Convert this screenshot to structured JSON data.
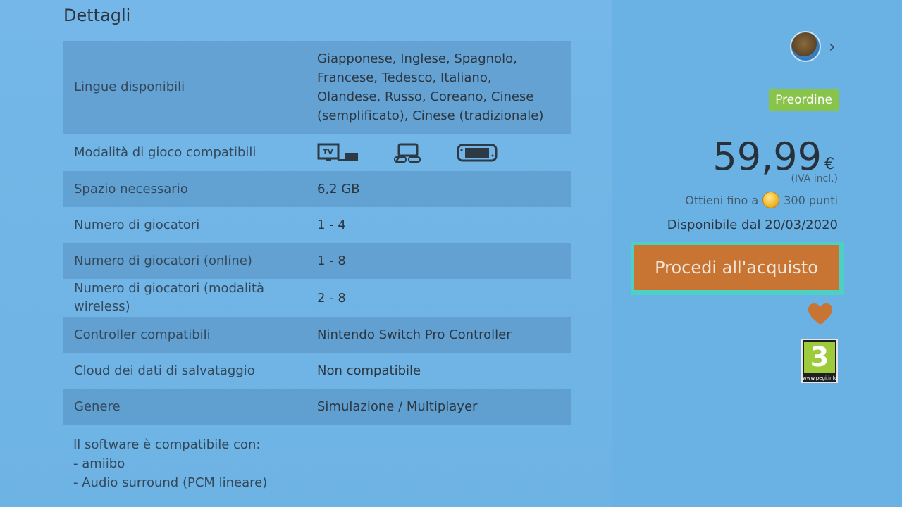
{
  "details": {
    "title": "Dettagli",
    "rows": [
      {
        "key": "Lingue disponibili",
        "value_lines": [
          "Giapponese, Inglese, Spagnolo,",
          "Francese, Tedesco, Italiano,",
          "Olandese, Russo, Coreano, Cinese",
          "(semplificato), Cinese (tradizionale)"
        ]
      },
      {
        "key": "Modalità di gioco compatibili",
        "modes": [
          "tv-mode-icon",
          "tabletop-mode-icon",
          "handheld-mode-icon"
        ]
      },
      {
        "key": "Spazio necessario",
        "value": "6,2 GB"
      },
      {
        "key": "Numero di giocatori",
        "value": "1 - 4"
      },
      {
        "key": "Numero di giocatori (online)",
        "value": "1 - 8"
      },
      {
        "key_lines": [
          "Numero di giocatori (modalità",
          "wireless)"
        ],
        "value": "2 - 8"
      },
      {
        "key": "Controller compatibili",
        "value": "Nintendo Switch Pro Controller"
      },
      {
        "key": "Cloud dei dati di salvataggio",
        "value": "Non compatibile"
      },
      {
        "key": "Genere",
        "value": "Simulazione / Multiplayer"
      }
    ],
    "compat": {
      "heading": "Il software è compatibile con:",
      "items": [
        "- amiibo",
        "- Audio surround (PCM lineare)"
      ]
    }
  },
  "sidebar": {
    "badge": "Preordine",
    "price": "59,99",
    "currency": "€",
    "vat_note": "(IVA incl.)",
    "points_prefix": "Ottieni fino a",
    "points_value": "300 punti",
    "release": "Disponibile dal 20/03/2020",
    "buy_label": "Procedi all'acquisto",
    "rating": "3",
    "rating_url": "www.pegi.info"
  },
  "colors": {
    "background": "#6ab3e4",
    "badge": "#88c34a",
    "buy_button": "#c87433",
    "focus_ring": "#4ed0c4",
    "heart": "#c87433"
  }
}
